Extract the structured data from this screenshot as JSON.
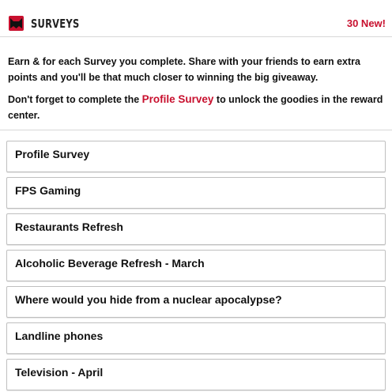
{
  "header": {
    "title": "SURVEYS",
    "badge": "30 New!",
    "logo_icon": "cat-logo-icon",
    "accent_color": "#c8102e"
  },
  "intro": {
    "paragraph1": "Earn & for each Survey you complete. Share with your friends to earn extra points and you'll be that much closer to winning the big giveaway.",
    "paragraph2_before": "Don't forget to complete the ",
    "paragraph2_link": "Profile Survey",
    "paragraph2_after": " to unlock the goodies in the reward center."
  },
  "surveys": [
    {
      "label": "Profile Survey"
    },
    {
      "label": "FPS Gaming"
    },
    {
      "label": "Restaurants Refresh"
    },
    {
      "label": "Alcoholic Beverage Refresh - March"
    },
    {
      "label": "Where would you hide from a nuclear apocalypse?"
    },
    {
      "label": "Landline phones"
    },
    {
      "label": "Television - April"
    }
  ]
}
